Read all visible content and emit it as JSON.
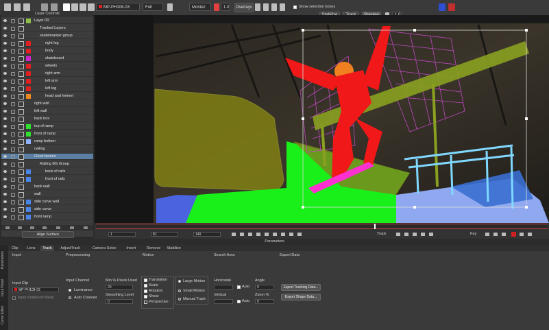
{
  "toolbar": {
    "clip_select": "MP-PH108-03",
    "view_mode": "Full",
    "channel_select": "Montez",
    "zoom_value": "1.0",
    "overlays_label": "Overlays",
    "show_selection_boxes_label": "Show selection boxes",
    "stabilize_label": "Stabilize",
    "track_label": "Track",
    "preview_label": "Preview",
    "ratio_value": "1.0"
  },
  "layer_panel": {
    "title": "Layer Controls",
    "rows": [
      {
        "name": "Layer 00",
        "indent": 0,
        "color": "#8fbf4a",
        "selected": false
      },
      {
        "name": "Tracked Layers",
        "indent": 1,
        "color": "",
        "selected": false
      },
      {
        "name": "skateboarder group",
        "indent": 1,
        "color": "",
        "selected": false
      },
      {
        "name": "right leg",
        "indent": 2,
        "color": "#e02020",
        "selected": false
      },
      {
        "name": "body",
        "indent": 2,
        "color": "#e02020",
        "selected": false
      },
      {
        "name": "skateboard",
        "indent": 2,
        "color": "#d024d0",
        "selected": false
      },
      {
        "name": "wheels",
        "indent": 2,
        "color": "#e02020",
        "selected": false
      },
      {
        "name": "right arm",
        "indent": 2,
        "color": "#e02020",
        "selected": false
      },
      {
        "name": "left arm",
        "indent": 2,
        "color": "#e02020",
        "selected": false
      },
      {
        "name": "left leg",
        "indent": 2,
        "color": "#e02020",
        "selected": false
      },
      {
        "name": "head and helmet",
        "indent": 2,
        "color": "#f08a20",
        "selected": false
      },
      {
        "name": "right wall",
        "indent": 0,
        "color": "",
        "selected": false
      },
      {
        "name": "left wall",
        "indent": 0,
        "color": "",
        "selected": false
      },
      {
        "name": "back box",
        "indent": 0,
        "color": "",
        "selected": false
      },
      {
        "name": "top of ramp",
        "indent": 0,
        "color": "#2fe02f",
        "selected": false
      },
      {
        "name": "front of ramp",
        "indent": 0,
        "color": "#2fe02f",
        "selected": false
      },
      {
        "name": "ramp bottom",
        "indent": 0,
        "color": "#8fb0ff",
        "selected": false
      },
      {
        "name": "ceiling",
        "indent": 0,
        "color": "",
        "selected": false
      },
      {
        "name": "Grind beams",
        "indent": 0,
        "color": "",
        "selected": true
      },
      {
        "name": "Railing BG Group",
        "indent": 1,
        "color": "",
        "selected": false
      },
      {
        "name": "back of rails",
        "indent": 2,
        "color": "#4a86e8",
        "selected": false
      },
      {
        "name": "front of rails",
        "indent": 2,
        "color": "#4a86e8",
        "selected": false
      },
      {
        "name": "back wall",
        "indent": 0,
        "color": "",
        "selected": false
      },
      {
        "name": "wall",
        "indent": 0,
        "color": "",
        "selected": false
      },
      {
        "name": "side curve wall",
        "indent": 0,
        "color": "#4a86e8",
        "selected": false
      },
      {
        "name": "side curve",
        "indent": 0,
        "color": "#4a86e8",
        "selected": false
      },
      {
        "name": "front ramp",
        "indent": 0,
        "color": "#4a86e8",
        "selected": false
      }
    ],
    "align_surface_label": "Align Surface"
  },
  "transport": {
    "start_frame": "1",
    "current_frame": "81",
    "end_frame": "140",
    "track_label": "Track",
    "key_label": "Key"
  },
  "params": {
    "title": "Parameters",
    "tabs": [
      {
        "label": "Clip",
        "active": false
      },
      {
        "label": "Lens",
        "active": false
      },
      {
        "label": "Track",
        "active": true
      },
      {
        "label": "AdjustTrack",
        "active": false
      },
      {
        "label": "Camera Solve",
        "active": false
      },
      {
        "label": "Insert",
        "active": false
      },
      {
        "label": "Remove",
        "active": false
      },
      {
        "label": "Stabilize",
        "active": false
      }
    ],
    "side_tabs": [
      "Parameters",
      "Input Panel",
      "Curve Editor"
    ],
    "columns": [
      "Input",
      "Preprocessing",
      "Motion",
      "Search Area",
      "Export Data"
    ],
    "input_clip_label": "Input Clip",
    "input_clip_value": "MP-PH108-03",
    "input_layer_label": "Input Stabilized Mask",
    "input_channel_label": "Input Channel",
    "luminance_label": "Luminance",
    "auto_channel_label": "Auto Channel",
    "min_pixels_label": "Min % Pixels Used",
    "min_pixels_value": "20",
    "smoothing_label": "Smoothing Level",
    "smoothing_value": "0",
    "translation_label": "Translation",
    "scale_label": "Scale",
    "rotation_label": "Rotation",
    "shear_label": "Shear",
    "perspective_label": "Perspective",
    "large_motion_label": "Large Motion",
    "small_motion_label": "Small Motion",
    "manual_track_label": "Manual Track",
    "horizontal_label": "Horizontal",
    "vertical_label": "Vertical",
    "auto_label": "Auto",
    "angle_label": "Angle",
    "angle_value": "0",
    "zoom_label": "Zoom %",
    "zoom_value": "0",
    "export_tracking_label": "Export Tracking Data...",
    "export_shape_label": "Export Shape Data..."
  }
}
